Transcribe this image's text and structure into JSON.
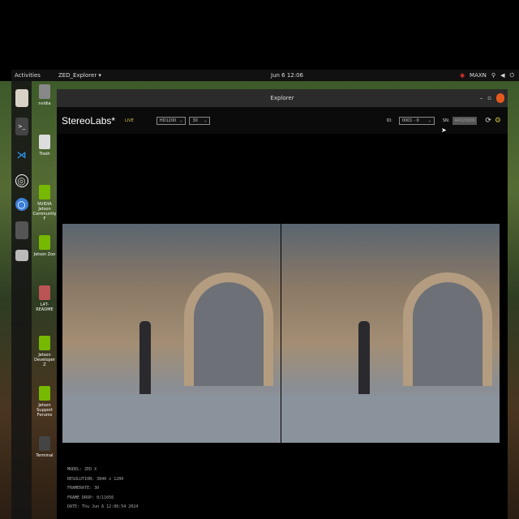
{
  "topbar": {
    "activities": "Activities",
    "app_menu": "ZED_Explorer ▾",
    "clock": "Jun 6  12:06",
    "power_mode": "MAXN"
  },
  "dock": [
    "files-icon",
    "terminal-icon",
    "vscode-icon",
    "obs-icon",
    "chromium-icon",
    "blank-icon",
    "drive-icon"
  ],
  "desktop": [
    {
      "label": "nvidia"
    },
    {
      "label": "Trash"
    },
    {
      "label": "NVIDIA Jetson Community F"
    },
    {
      "label": "Jetson Zoo"
    },
    {
      "label": "L4T-README"
    },
    {
      "label": "Jetson Developer Z"
    },
    {
      "label": "Jetson Support Forums"
    },
    {
      "label": "Terminal"
    }
  ],
  "window": {
    "title": "Explorer"
  },
  "header": {
    "logo": "StereoLabs*",
    "live": "LIVE",
    "resolution": "HD1200",
    "fps": "30",
    "id_label": "ID:",
    "id_value": "0001 - 0",
    "sn_label": "SN:",
    "sn_value": "44020806"
  },
  "info": {
    "model": "MODEL: ZED X",
    "resolution": "RESOLUTION: 3840 x 1200",
    "framerate": "FRAMERATE: 30",
    "frame_drop": "FRAME DROP: 0/11656",
    "date": "DATE: Thu Jun 6 12:06:54 2024"
  }
}
